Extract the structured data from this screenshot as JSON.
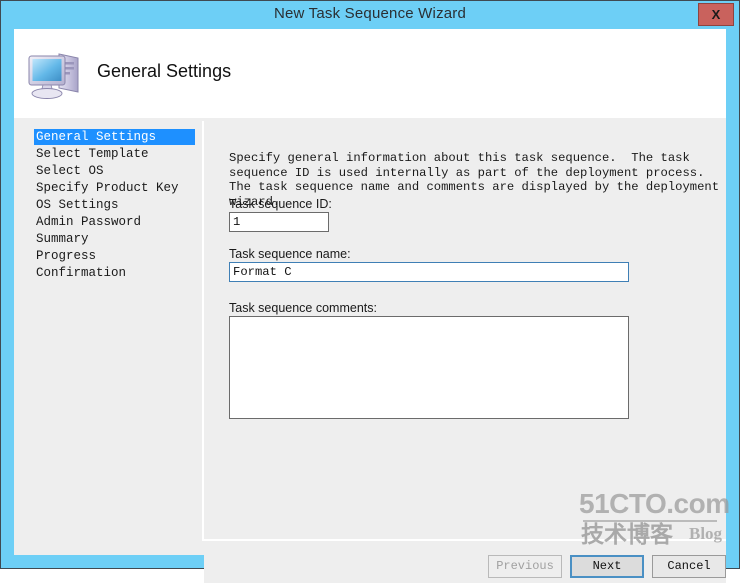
{
  "window": {
    "title": "New Task Sequence Wizard",
    "close_label": "X",
    "frame_color": "#6dcff6",
    "panel_color": "#eeeeee"
  },
  "header": {
    "page_title": "General Settings",
    "icon": "computer-icon"
  },
  "sidebar": {
    "items": [
      {
        "label": "General Settings",
        "active": true
      },
      {
        "label": "Select Template",
        "active": false
      },
      {
        "label": "Select OS",
        "active": false
      },
      {
        "label": "Specify Product Key",
        "active": false
      },
      {
        "label": "OS Settings",
        "active": false
      },
      {
        "label": "Admin Password",
        "active": false
      },
      {
        "label": "Summary",
        "active": false
      },
      {
        "label": "Progress",
        "active": false
      },
      {
        "label": "Confirmation",
        "active": false
      }
    ],
    "active_color": "#1e90ff"
  },
  "content": {
    "intro": "Specify general information about this task sequence.  The task sequence ID is used internally as part of the deployment process.  The task sequence name and comments are displayed by the deployment wizard.",
    "fields": {
      "id_label": "Task sequence ID:",
      "id_value": "1",
      "name_label": "Task sequence name:",
      "name_value": "Format C",
      "comments_label": "Task sequence comments:",
      "comments_value": "",
      "comments_placeholder": ""
    }
  },
  "footer": {
    "previous_label": "Previous",
    "next_label": "Next",
    "cancel_label": "Cancel",
    "previous_disabled": true
  },
  "watermark": {
    "top": "51CTO.com",
    "cn": "技术博客",
    "blog": "Blog"
  }
}
